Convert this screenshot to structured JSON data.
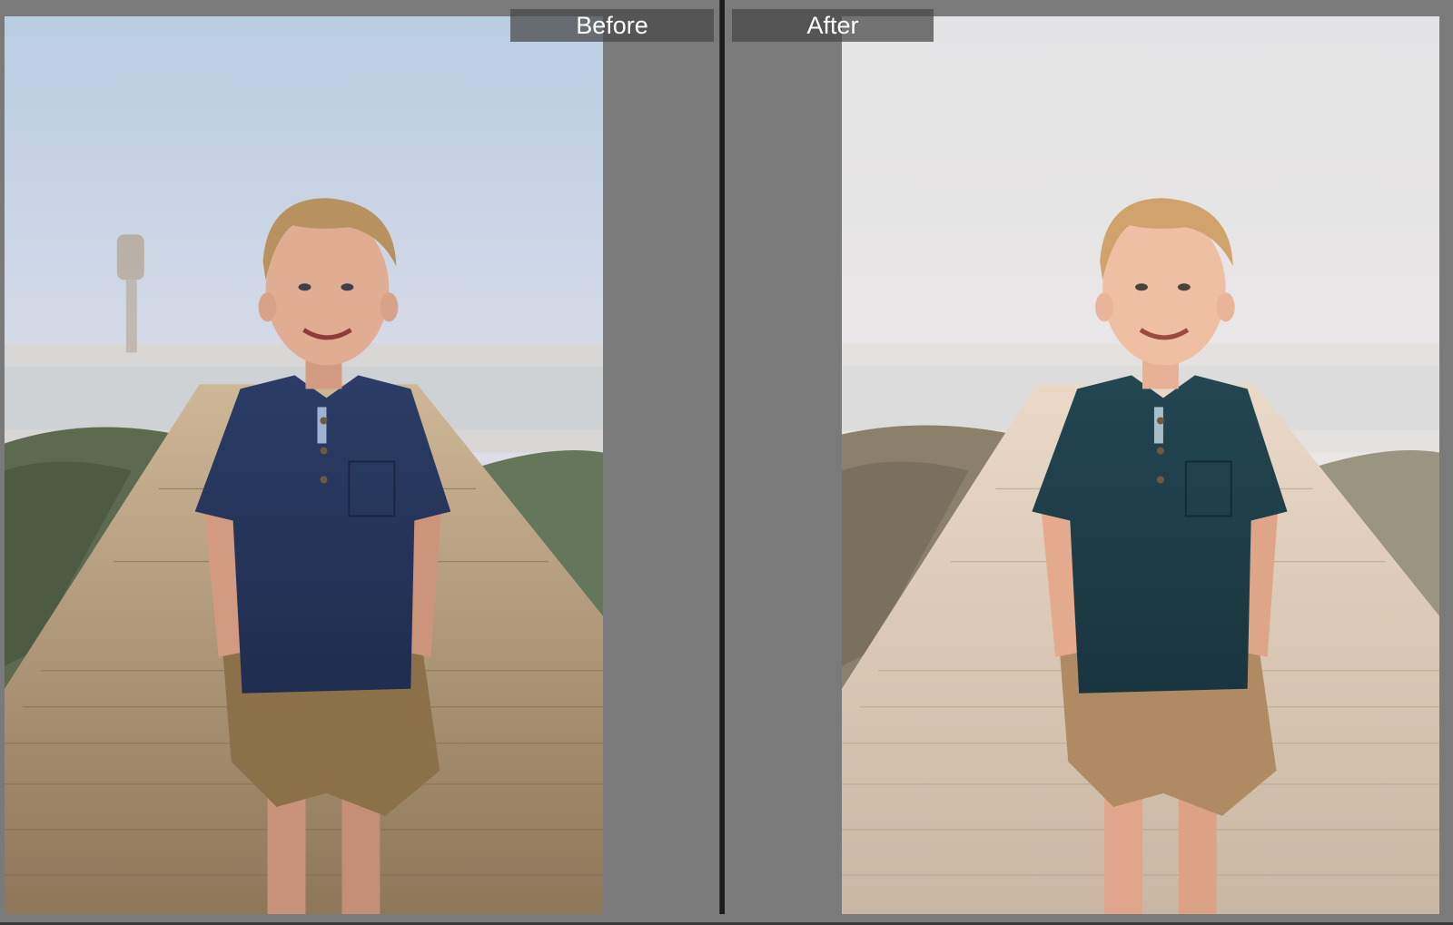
{
  "window": {
    "mode": "before-after-compare"
  },
  "panes": {
    "before": {
      "label": "Before",
      "tone": "cool-blue",
      "shirt_color": "#22335a",
      "sky_color_top": "#b8cbe0",
      "sky_color_bottom": "#e9e4ec"
    },
    "after": {
      "label": "After",
      "tone": "warm-faded",
      "shirt_color": "#1c3b46",
      "sky_color_top": "#e6e6e8",
      "sky_color_bottom": "#ece8e6"
    }
  },
  "colors": {
    "view_background": "#7a7a7a",
    "divider": "#1c1c1c",
    "label_background": "#464646",
    "label_text": "#ffffff"
  }
}
